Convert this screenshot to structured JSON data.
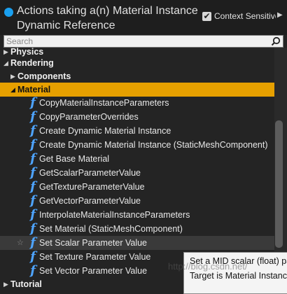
{
  "header": {
    "title": "Actions taking a(n) Material Instance Dynamic Reference",
    "context_checkbox_mark": "✔",
    "context_sensitive_label": "Context Sensitive",
    "context_arrow": "▶"
  },
  "search": {
    "placeholder": "Search",
    "value": ""
  },
  "tree": {
    "physics": "Physics",
    "rendering": "Rendering",
    "components": "Components",
    "material": "Material",
    "tutorial": "Tutorial",
    "functions": [
      "CopyMaterialInstanceParameters",
      "CopyParameterOverrides",
      "Create Dynamic Material Instance",
      "Create Dynamic Material Instance (StaticMeshComponent)",
      "Get Base Material",
      "GetScalarParameterValue",
      "GetTextureParameterValue",
      "GetVectorParameterValue",
      "InterpolateMaterialInstanceParameters",
      "Set Material (StaticMeshComponent)",
      "Set Scalar Parameter Value",
      "Set Texture Parameter Value",
      "Set Vector Parameter Value"
    ]
  },
  "tooltip": {
    "line1": "Set a MID scalar (float) parameter value",
    "line2": "Target is Material Instance Dynamic"
  },
  "watermark": "http://blog.csdn.net/",
  "colors": {
    "selection": "#e6a000",
    "function_icon": "#4ea4ff",
    "title_dot": "#1aa0f0"
  }
}
